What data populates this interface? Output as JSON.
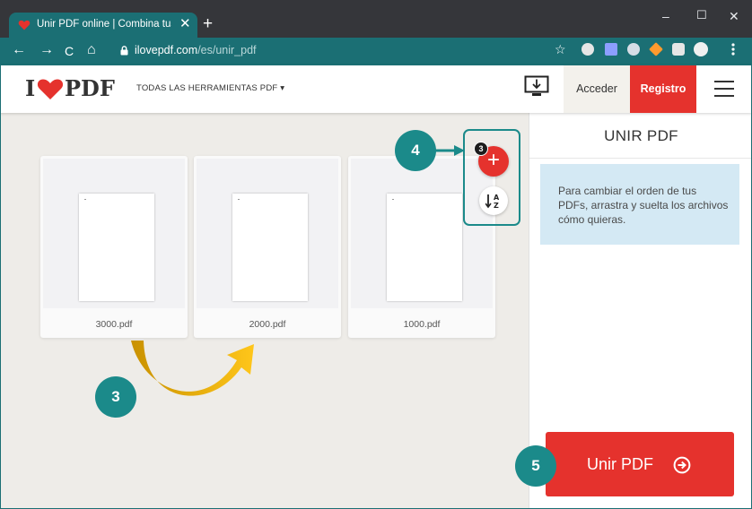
{
  "browser": {
    "tab_title": "Unir PDF online | Combina tus ar",
    "tab_close": "✕",
    "new_tab": "+",
    "window_controls": {
      "minimize": "–",
      "maximize": "☐",
      "close": "✕"
    },
    "nav": {
      "back": "←",
      "forward": "→",
      "reload": "C",
      "home": "⌂"
    },
    "url_host": "ilovepdf.com",
    "url_path": "/es/unir_pdf",
    "bookmark_icon": "☆",
    "extensions": [
      "globe-icon",
      "facebook-icon",
      "speed-icon",
      "diamond-icon",
      "puzzle-icon",
      "profile-icon",
      "menu-icon"
    ]
  },
  "header": {
    "logo_left": "I",
    "logo_right": "PDF",
    "tools_label": "TODAS LAS HERRAMIENTAS PDF ▾",
    "login_label": "Acceder",
    "signup_label": "Registro"
  },
  "files": [
    {
      "name": "3000.pdf"
    },
    {
      "name": "2000.pdf"
    },
    {
      "name": "1000.pdf"
    }
  ],
  "controls": {
    "add_symbol": "+",
    "file_count": "3"
  },
  "steps": {
    "reorder": "3",
    "add": "4",
    "merge": "5"
  },
  "panel": {
    "title": "UNIR PDF",
    "info_text": "Para cambiar el orden de tus PDFs, arrastra y suelta los archivos cómo quieras.",
    "merge_button": "Unir PDF"
  },
  "colors": {
    "brand_red": "#e5322d",
    "chrome_teal": "#1b6f74",
    "annotation_teal": "#1b8a8a",
    "arrow_gold": "#f2b705",
    "info_bg": "#d4e9f4"
  }
}
